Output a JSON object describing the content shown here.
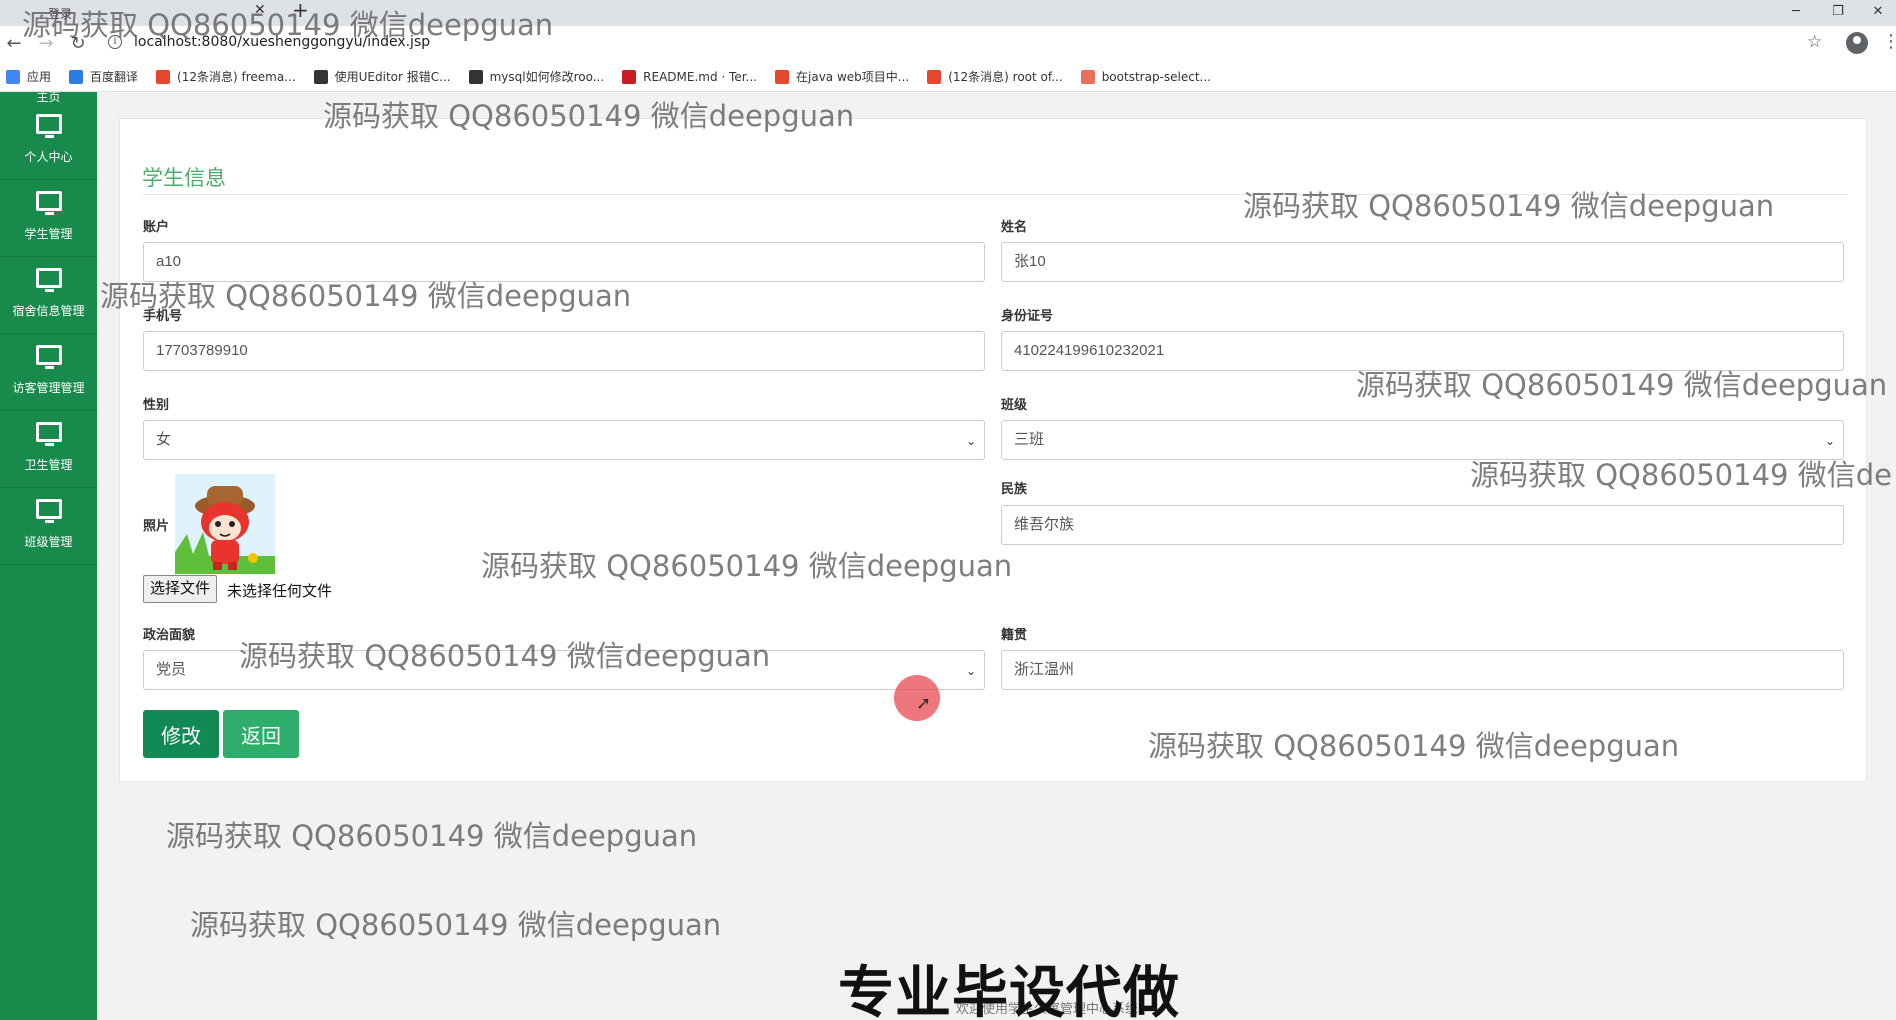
{
  "browser": {
    "tab_title": "登录",
    "url": "localhost:8080/xueshenggongyu/index.jsp",
    "bookmarks": [
      {
        "label": "应用",
        "icon": "apps-grid-icon",
        "color": "#4285f4"
      },
      {
        "label": "百度翻译",
        "icon": "baidu-translate-icon",
        "color": "#2a7be4"
      },
      {
        "label": "(12条消息) freema...",
        "icon": "csdn-icon",
        "color": "#e8462c"
      },
      {
        "label": "使用UEditor 报错C...",
        "icon": "ueditor-icon",
        "color": "#333333"
      },
      {
        "label": "mysql如何修改roo...",
        "icon": "ueditor-icon",
        "color": "#333333"
      },
      {
        "label": "README.md · Ter...",
        "icon": "gitee-icon",
        "color": "#c71d23"
      },
      {
        "label": "在java web项目中...",
        "icon": "csdn-icon",
        "color": "#e8462c"
      },
      {
        "label": "(12条消息) root of...",
        "icon": "csdn-icon",
        "color": "#e8462c"
      },
      {
        "label": "bootstrap-select...",
        "icon": "jianshu-icon",
        "color": "#ea6f5a"
      }
    ]
  },
  "sidebar": {
    "partial_label": "主页",
    "items": [
      {
        "label": "个人中心",
        "icon": "monitor-icon"
      },
      {
        "label": "学生管理",
        "icon": "monitor-icon"
      },
      {
        "label": "宿舍信息管理",
        "icon": "monitor-icon"
      },
      {
        "label": "访客管理管理",
        "icon": "monitor-icon"
      },
      {
        "label": "卫生管理",
        "icon": "monitor-icon"
      },
      {
        "label": "班级管理",
        "icon": "monitor-icon"
      }
    ]
  },
  "form": {
    "title": "学生信息",
    "account": {
      "label": "账户",
      "value": "a10"
    },
    "name": {
      "label": "姓名",
      "value": "张10"
    },
    "phone": {
      "label": "手机号",
      "value": "17703789910"
    },
    "id_card": {
      "label": "身份证号",
      "value": "410224199610232021"
    },
    "gender": {
      "label": "性别",
      "value": "女"
    },
    "class": {
      "label": "班级",
      "value": "三班"
    },
    "photo": {
      "label": "照片",
      "file_button": "选择文件",
      "file_status": "未选择任何文件"
    },
    "ethnicity": {
      "label": "民族",
      "value": "维吾尔族"
    },
    "political": {
      "label": "政治面貌",
      "value": "党员"
    },
    "hometown": {
      "label": "籍贯",
      "value": "浙江温州"
    },
    "buttons": {
      "edit": "修改",
      "back": "返回"
    }
  },
  "overlay": {
    "watermark": "源码获取 QQ86050149 微信deepguan",
    "watermark_partial": "源码获取 QQ86050149 微信de",
    "banner": "专业毕设代做",
    "banner_sub": "欢迎使用学生公寓管理中心系统"
  },
  "colors": {
    "sidebar": "#188a4c",
    "accent": "#4cae6c",
    "edit_button": "#128a55",
    "back_button": "#2eae6a"
  }
}
